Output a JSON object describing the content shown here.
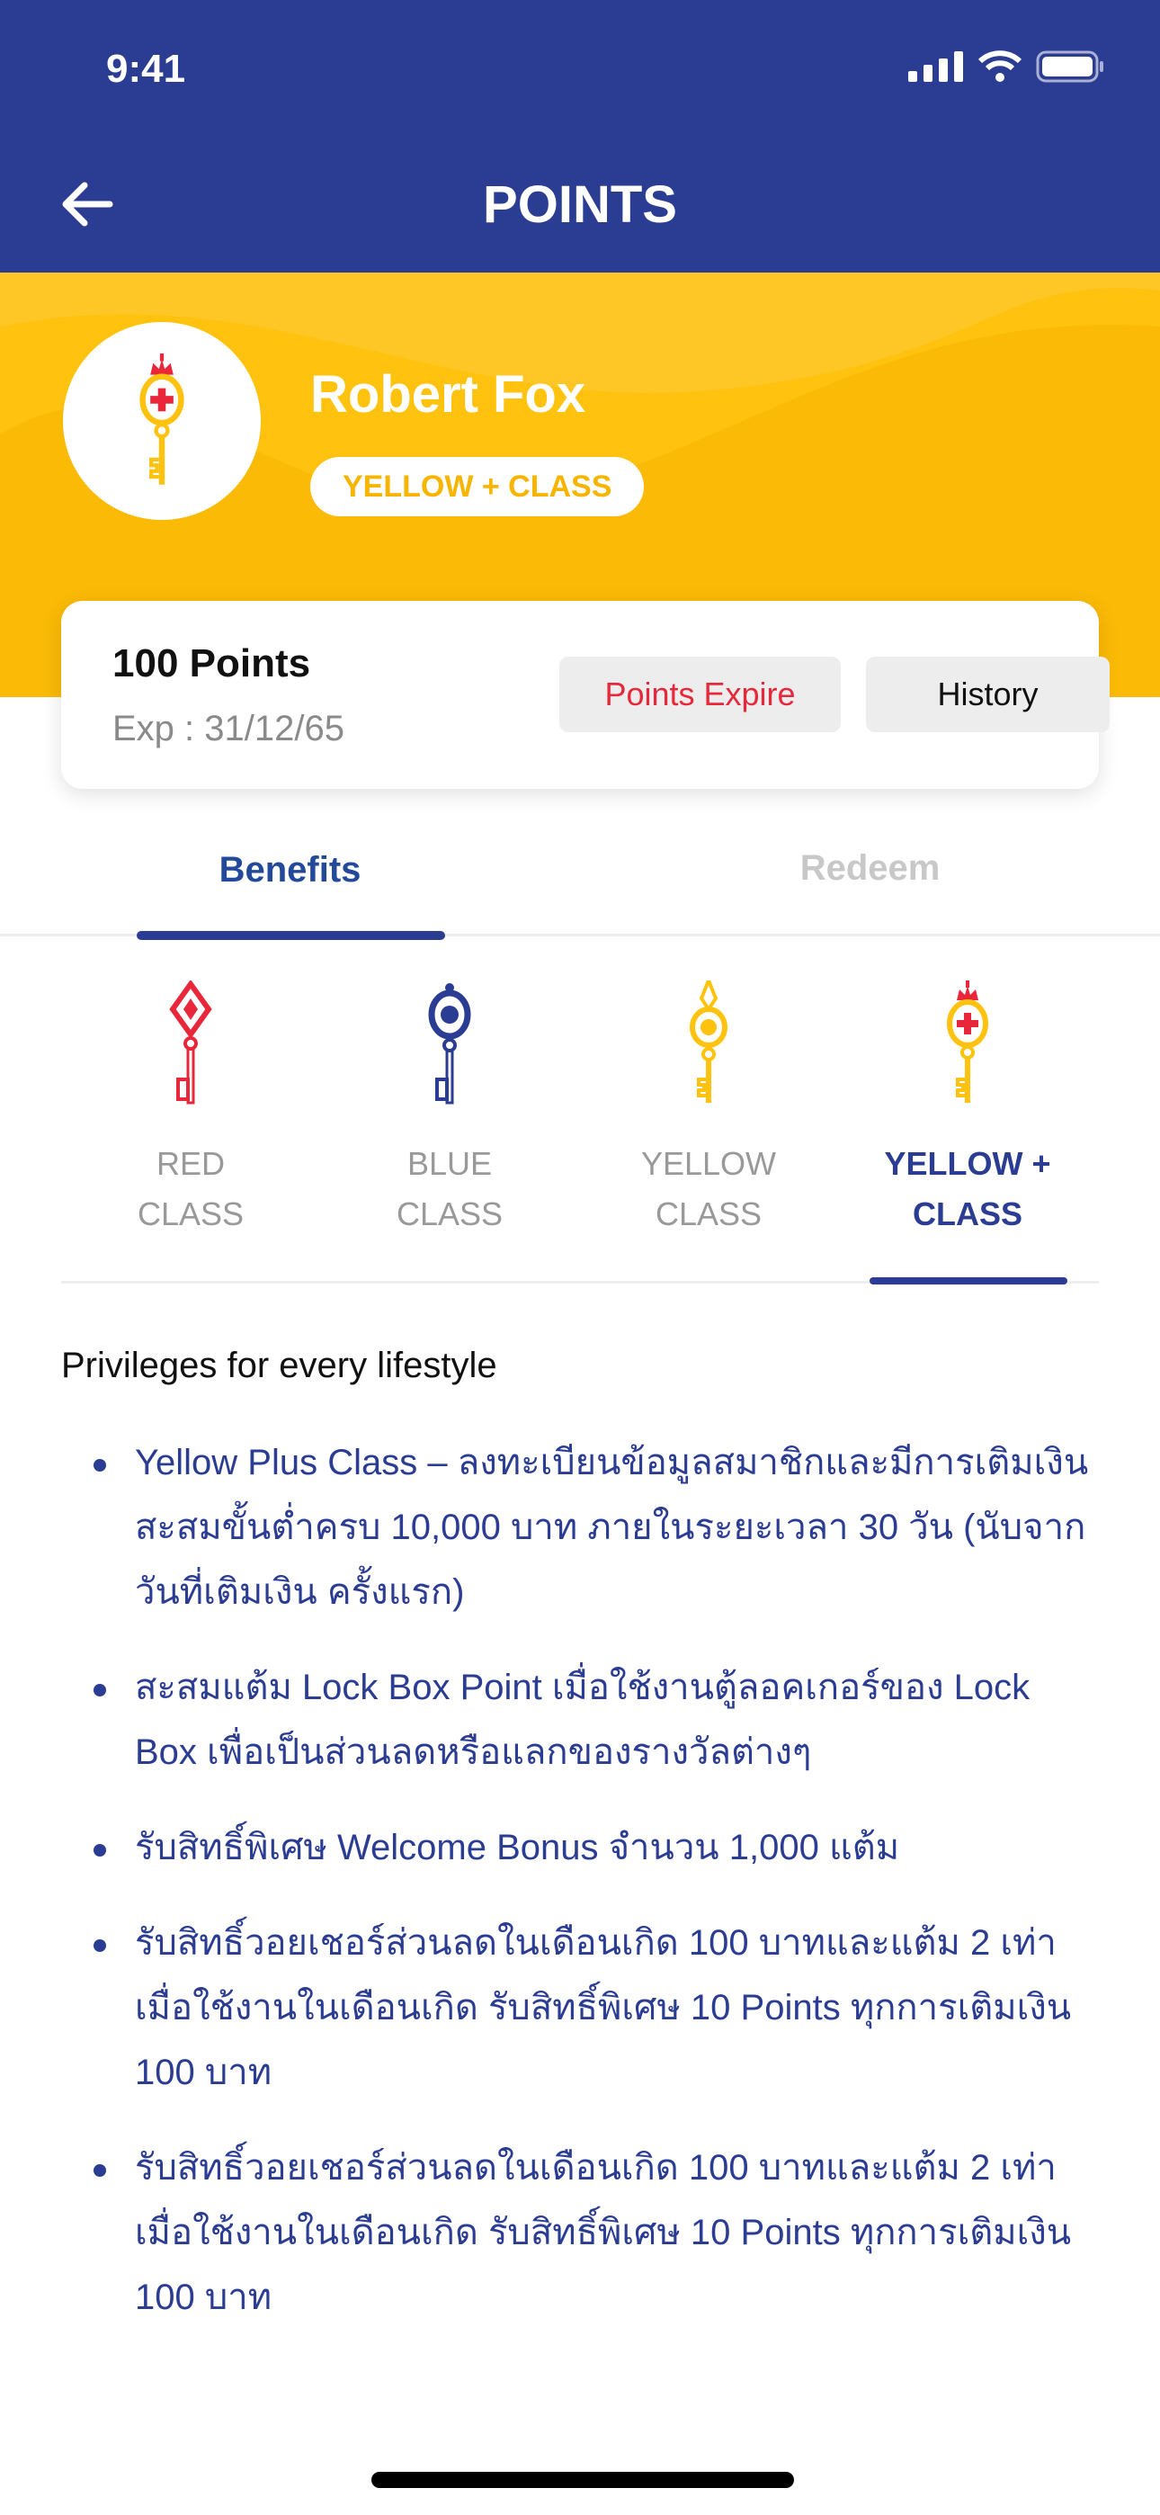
{
  "status_bar": {
    "time": "9:41"
  },
  "header": {
    "title": "POINTS"
  },
  "profile": {
    "name": "Robert Fox",
    "tier_badge": "YELLOW + CLASS"
  },
  "points_card": {
    "points": "100 Points",
    "expiry": "Exp : 31/12/65",
    "points_expire_button": "Points Expire",
    "history_button": "History"
  },
  "tabs": [
    {
      "label": "Benefits",
      "active": true
    },
    {
      "label": "Redeem",
      "active": false
    }
  ],
  "classes": [
    {
      "line1": "RED",
      "line2": "CLASS",
      "color": "#E8283A"
    },
    {
      "line1": "BLUE",
      "line2": "CLASS",
      "color": "#2B3C93"
    },
    {
      "line1": "YELLOW",
      "line2": "CLASS",
      "color": "#FFC20E"
    },
    {
      "line1": "YELLOW +",
      "line2": "CLASS",
      "color": "#FFC20E",
      "active": true
    }
  ],
  "benefits": {
    "heading": "Privileges for every lifestyle",
    "items": [
      "Yellow Plus Class – ลงทะเบียนข้อมูลสมาชิกและมีการเติมเงินสะสมขั้นต่ำครบ 10,000 บาท ภายในระยะเวลา 30 วัน (นับจากวันที่เติมเงิน ครั้งแรก)",
      "สะสมแต้ม Lock Box Point เมื่อใช้งานตู้ลอคเกอร์ของ Lock Box เพื่อเป็นส่วนลดหรือแลกของรางวัลต่างๆ",
      "รับสิทธิ์พิเศษ Welcome Bonus จำนวน 1,000 แต้ม",
      "รับสิทธิ์วอยเชอร์ส่วนลดในเดือนเกิด 100 บาทและแต้ม 2 เท่าเมื่อใช้งานในเดือนเกิด รับสิทธิ์พิเศษ 10 Points ทุกการเติมเงิน 100 บาท",
      "รับสิทธิ์วอยเชอร์ส่วนลดในเดือนเกิด 100 บาทและแต้ม 2 เท่าเมื่อใช้งานในเดือนเกิด รับสิทธิ์พิเศษ 10 Points ทุกการเติมเงิน 100 บาท"
    ]
  },
  "colors": {
    "primary": "#2B3C93",
    "yellow": "#FFC20E",
    "red": "#E8283A"
  }
}
